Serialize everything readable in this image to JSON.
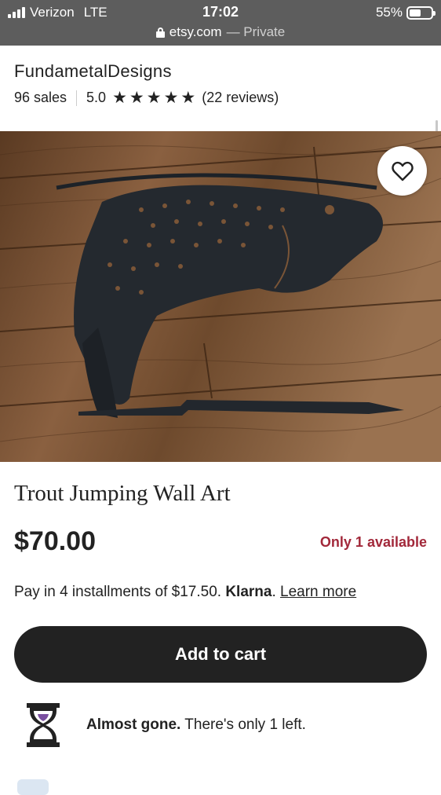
{
  "status_bar": {
    "carrier": "Verizon",
    "network": "LTE",
    "time": "17:02",
    "battery": "55%",
    "battery_level": 0.55
  },
  "browser": {
    "host": "etsy.com",
    "mode": "— Private"
  },
  "shop": {
    "name": "FundametalDesigns",
    "sales": "96 sales",
    "rating": "5.0",
    "stars": 5,
    "reviews": "(22 reviews)"
  },
  "listing": {
    "title": "Trout Jumping Wall Art",
    "price": "$70.00",
    "availability": "Only 1 available",
    "installments_text": "Pay in 4 installments of $17.50.",
    "klarna": "Klarna",
    "learn_more": "Learn more",
    "add_to_cart": "Add to cart",
    "scarcity_bold": "Almost gone.",
    "scarcity_text": "There's only 1 left."
  },
  "icons": {
    "favorite": "heart-outline-icon",
    "scarcity": "hourglass-icon",
    "lock": "lock-icon"
  },
  "colors": {
    "status_bar": "#5d5d5d",
    "availability": "#a2283a",
    "button": "#222222",
    "hourglass_sand": "#7a4fa0"
  }
}
